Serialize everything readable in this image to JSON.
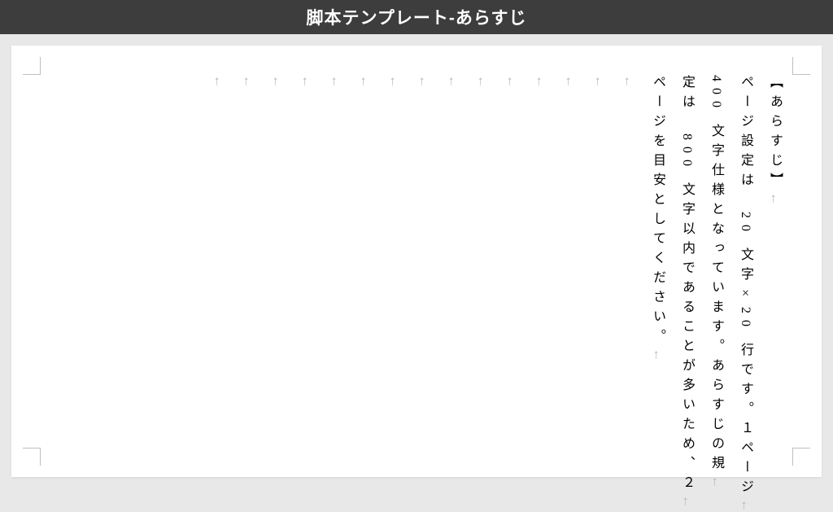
{
  "header": {
    "title": "脚本テンプレート-あらすじ"
  },
  "document": {
    "paragraph_mark": "←",
    "lines": [
      {
        "text": "【あらすじ】",
        "empty": false
      },
      {
        "text": "ページ設定は　20 文字×20 行です。１ページ",
        "empty": false
      },
      {
        "text": "400 文字仕様となっています。あらすじの規",
        "empty": false
      },
      {
        "text": "定は　800 文字以内であることが多いため、２",
        "empty": false
      },
      {
        "text": "ページを目安としてください。",
        "empty": false
      },
      {
        "text": "",
        "empty": true
      },
      {
        "text": "",
        "empty": true
      },
      {
        "text": "",
        "empty": true
      },
      {
        "text": "",
        "empty": true
      },
      {
        "text": "",
        "empty": true
      },
      {
        "text": "",
        "empty": true
      },
      {
        "text": "",
        "empty": true
      },
      {
        "text": "",
        "empty": true
      },
      {
        "text": "",
        "empty": true
      },
      {
        "text": "",
        "empty": true
      },
      {
        "text": "",
        "empty": true
      },
      {
        "text": "",
        "empty": true
      },
      {
        "text": "",
        "empty": true
      },
      {
        "text": "",
        "empty": true
      },
      {
        "text": "",
        "empty": true
      }
    ]
  }
}
